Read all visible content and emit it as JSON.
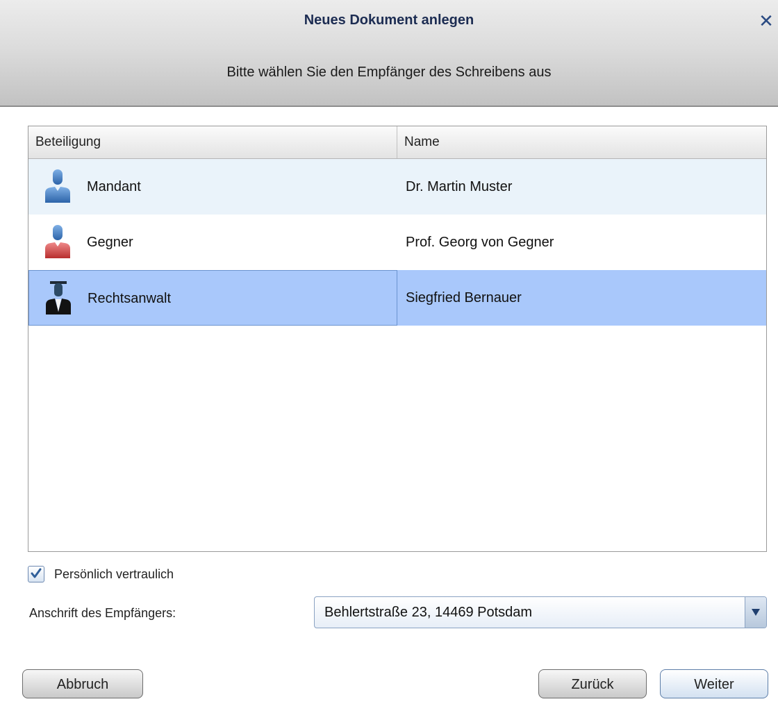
{
  "dialog": {
    "title": "Neues Dokument anlegen",
    "close_icon": "close-icon",
    "subtitle": "Bitte wählen Sie den Empfänger des Schreibens aus"
  },
  "table": {
    "columns": [
      "Beteiligung",
      "Name"
    ],
    "rows": [
      {
        "role": "Mandant",
        "name": "Dr. Martin Muster",
        "icon": "person-blue-icon",
        "selected": false
      },
      {
        "role": "Gegner",
        "name": "Prof. Georg von Gegner",
        "icon": "person-red-icon",
        "selected": false
      },
      {
        "role": "Rechtsanwalt",
        "name": "Siegfried Bernauer",
        "icon": "lawyer-icon",
        "selected": true
      }
    ]
  },
  "options": {
    "confidential_label": "Persönlich vertraulich",
    "confidential_checked": true
  },
  "address": {
    "label": "Anschrift des Empfängers:",
    "selected": "Behlertstraße 23, 14469 Potsdam"
  },
  "buttons": {
    "cancel": "Abbruch",
    "back": "Zurück",
    "next": "Weiter"
  },
  "colors": {
    "title": "#1c2c52",
    "selected_row": "#a9c8fb",
    "alt_row": "#eaf3fa",
    "mandant_icon": "#4a80c4",
    "gegner_icon": "#d64a4a"
  }
}
